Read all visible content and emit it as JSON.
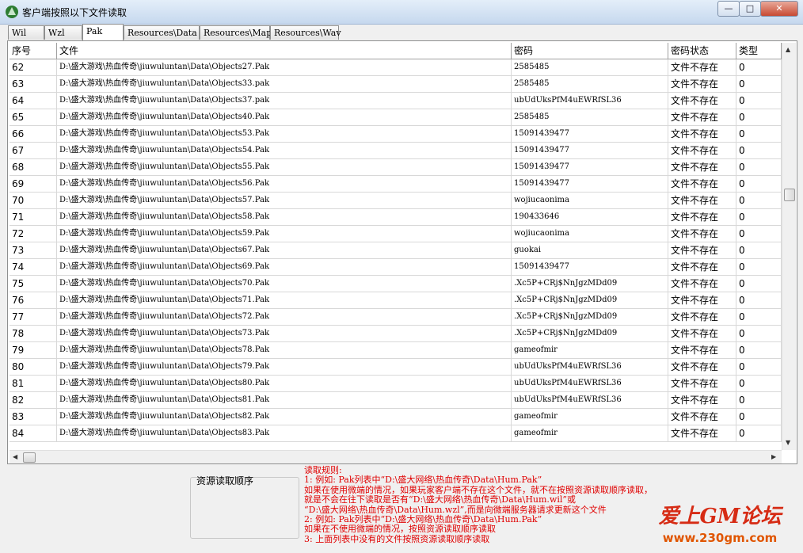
{
  "window": {
    "title": "客户端按照以下文件读取",
    "controls": {
      "minimize": "—",
      "maximize": "□",
      "close": "✕"
    }
  },
  "tabs": [
    {
      "label": "Wil",
      "active": false
    },
    {
      "label": "Wzl",
      "active": false
    },
    {
      "label": "Pak",
      "active": true
    },
    {
      "label": "Resources\\Data",
      "active": false
    },
    {
      "label": "Resources\\Map",
      "active": false
    },
    {
      "label": "Resources\\Wav",
      "active": false
    }
  ],
  "table": {
    "columns": [
      "序号",
      "文件",
      "密码",
      "密码状态",
      "类型"
    ],
    "rows": [
      [
        "62",
        "D:\\盛大游戏\\热血传奇\\jiuwuluntan\\Data\\Objects27.Pak",
        "2585485",
        "文件不存在",
        "0"
      ],
      [
        "63",
        "D:\\盛大游戏\\热血传奇\\jiuwuluntan\\Data\\Objects33.pak",
        "2585485",
        "文件不存在",
        "0"
      ],
      [
        "64",
        "D:\\盛大游戏\\热血传奇\\jiuwuluntan\\Data\\Objects37.pak",
        "ubUdUksPfM4uEWRfSL36",
        "文件不存在",
        "0"
      ],
      [
        "65",
        "D:\\盛大游戏\\热血传奇\\jiuwuluntan\\Data\\Objects40.Pak",
        "2585485",
        "文件不存在",
        "0"
      ],
      [
        "66",
        "D:\\盛大游戏\\热血传奇\\jiuwuluntan\\Data\\Objects53.Pak",
        "15091439477",
        "文件不存在",
        "0"
      ],
      [
        "67",
        "D:\\盛大游戏\\热血传奇\\jiuwuluntan\\Data\\Objects54.Pak",
        "15091439477",
        "文件不存在",
        "0"
      ],
      [
        "68",
        "D:\\盛大游戏\\热血传奇\\jiuwuluntan\\Data\\Objects55.Pak",
        "15091439477",
        "文件不存在",
        "0"
      ],
      [
        "69",
        "D:\\盛大游戏\\热血传奇\\jiuwuluntan\\Data\\Objects56.Pak",
        "15091439477",
        "文件不存在",
        "0"
      ],
      [
        "70",
        "D:\\盛大游戏\\热血传奇\\jiuwuluntan\\Data\\Objects57.Pak",
        "wojiucaonima",
        "文件不存在",
        "0"
      ],
      [
        "71",
        "D:\\盛大游戏\\热血传奇\\jiuwuluntan\\Data\\Objects58.Pak",
        "190433646",
        "文件不存在",
        "0"
      ],
      [
        "72",
        "D:\\盛大游戏\\热血传奇\\jiuwuluntan\\Data\\Objects59.Pak",
        "wojiucaonima",
        "文件不存在",
        "0"
      ],
      [
        "73",
        "D:\\盛大游戏\\热血传奇\\jiuwuluntan\\Data\\Objects67.Pak",
        "guokai",
        "文件不存在",
        "0"
      ],
      [
        "74",
        "D:\\盛大游戏\\热血传奇\\jiuwuluntan\\Data\\Objects69.Pak",
        "15091439477",
        "文件不存在",
        "0"
      ],
      [
        "75",
        "D:\\盛大游戏\\热血传奇\\jiuwuluntan\\Data\\Objects70.Pak",
        ".Xc5P+CRj$NnJgzMDd09",
        "文件不存在",
        "0"
      ],
      [
        "76",
        "D:\\盛大游戏\\热血传奇\\jiuwuluntan\\Data\\Objects71.Pak",
        ".Xc5P+CRj$NnJgzMDd09",
        "文件不存在",
        "0"
      ],
      [
        "77",
        "D:\\盛大游戏\\热血传奇\\jiuwuluntan\\Data\\Objects72.Pak",
        ".Xc5P+CRj$NnJgzMDd09",
        "文件不存在",
        "0"
      ],
      [
        "78",
        "D:\\盛大游戏\\热血传奇\\jiuwuluntan\\Data\\Objects73.Pak",
        ".Xc5P+CRj$NnJgzMDd09",
        "文件不存在",
        "0"
      ],
      [
        "79",
        "D:\\盛大游戏\\热血传奇\\jiuwuluntan\\Data\\Objects78.Pak",
        "gameofmir",
        "文件不存在",
        "0"
      ],
      [
        "80",
        "D:\\盛大游戏\\热血传奇\\jiuwuluntan\\Data\\Objects79.Pak",
        "ubUdUksPfM4uEWRfSL36",
        "文件不存在",
        "0"
      ],
      [
        "81",
        "D:\\盛大游戏\\热血传奇\\jiuwuluntan\\Data\\Objects80.Pak",
        "ubUdUksPfM4uEWRfSL36",
        "文件不存在",
        "0"
      ],
      [
        "82",
        "D:\\盛大游戏\\热血传奇\\jiuwuluntan\\Data\\Objects81.Pak",
        "ubUdUksPfM4uEWRfSL36",
        "文件不存在",
        "0"
      ],
      [
        "83",
        "D:\\盛大游戏\\热血传奇\\jiuwuluntan\\Data\\Objects82.Pak",
        "gameofmir",
        "文件不存在",
        "0"
      ],
      [
        "84",
        "D:\\盛大游戏\\热血传奇\\jiuwuluntan\\Data\\Objects83.Pak",
        "gameofmir",
        "文件不存在",
        "0"
      ]
    ]
  },
  "scroll": {
    "vertical_position": 0.36,
    "horizontal_position": 0.0
  },
  "order_label": "资源读取顺序",
  "rules": {
    "lines": [
      "读取规则:",
      "1: 例如: Pak列表中“D:\\盛大网络\\热血传奇\\Data\\Hum.Pak”",
      "    如果在使用微端的情况，如果玩家客户端不存在这个文件，就不在按照资源读取顺序读取，",
      "    就是不会在往下读取是否有“D:\\盛大网络\\热血传奇\\Data\\Hum.wil”或",
      "    “D:\\盛大网络\\热血传奇\\Data\\Hum.wzl”,而是向微端服务器请求更新这个文件",
      "2: 例如: Pak列表中“D:\\盛大网络\\热血传奇\\Data\\Hum.Pak”",
      "    如果在不使用微端的情况，按照资源读取顺序读取",
      "3: 上面列表中没有的文件按照资源读取顺序读取"
    ]
  },
  "watermark": {
    "line1": "爱上GM论坛",
    "line2": "www.230gm.com"
  },
  "colors": {
    "rules_text": "#e00000",
    "watermark_red": "#d62b14",
    "watermark_orange": "#e05500"
  }
}
